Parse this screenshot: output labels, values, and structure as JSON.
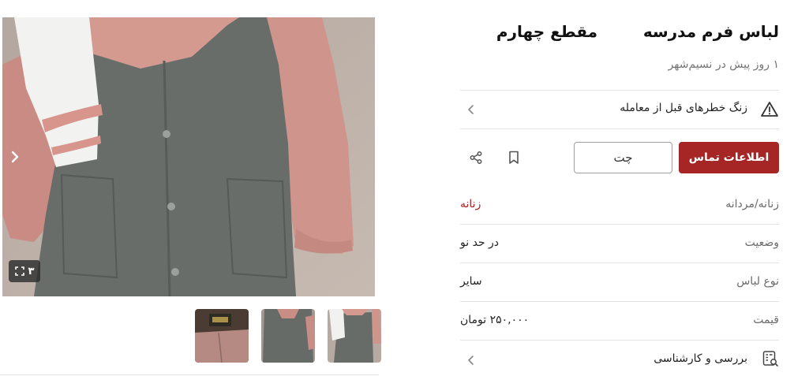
{
  "listing": {
    "title": "لباس فرم مدرسه",
    "title_extra": "مقطع چهارم",
    "posted": "۱ روز پیش در نسیم‌شهر"
  },
  "warning": {
    "text": "زنگ خطرهای قبل از معامله",
    "icon": "warning-triangle-icon"
  },
  "actions": {
    "contact_label": "اطلاعات تماس",
    "chat_label": "چت",
    "bookmark_icon": "bookmark-icon",
    "share_icon": "share-icon",
    "accent_color": "#a62626"
  },
  "attributes": [
    {
      "label": "زنانه/مردانه",
      "value": "زنانه",
      "highlight": true
    },
    {
      "label": "وضعیت",
      "value": "در حد نو",
      "highlight": false
    },
    {
      "label": "نوع لباس",
      "value": "سایر",
      "highlight": false
    },
    {
      "label": "قیمت",
      "value": "۲۵۰,۰۰۰ تومان",
      "highlight": false
    }
  ],
  "review": {
    "text": "بررسی و کارشناسی",
    "icon": "inspection-report-icon"
  },
  "gallery": {
    "image_count": "۳",
    "expand_icon": "fullscreen-icon",
    "next_icon": "chevron-right-icon",
    "thumbnails": [
      "thumbnail-1",
      "thumbnail-2",
      "thumbnail-3"
    ]
  }
}
